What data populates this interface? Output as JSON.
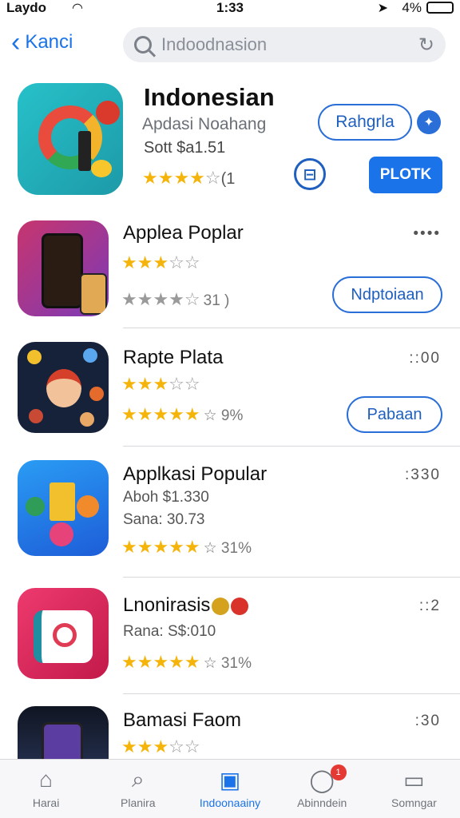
{
  "status_bar": {
    "carrier": "Laydo",
    "time": "1:33",
    "battery_pct": "4%"
  },
  "nav": {
    "back_label": "Kanci",
    "search_text": "Indoodnasion"
  },
  "featured": {
    "title": "Indonesian",
    "subtitle": "Apdasi Noahang",
    "price": "Sott $a1.51",
    "rating_count": "(1",
    "primary_button": "Rahgrla",
    "action_button": "PLOTK"
  },
  "rows": [
    {
      "name": "Applea Poplar",
      "stars_top": "★★★☆☆",
      "stars_bottom": "★★★★☆",
      "count": "31 )",
      "menu": "••••",
      "button": "Ndptoiaan"
    },
    {
      "name": "Rapte Plata",
      "stars_top": "★★★☆☆",
      "stars_bottom": "★★★★★",
      "count": "☆ 9%",
      "menu": "::00",
      "button": "Pabaan"
    },
    {
      "name": "Applkasi Popular",
      "sub1": "Aboh $1.330",
      "sub2": "Sana: 30.73",
      "stars_bottom": "★★★★★",
      "count": "☆ 31%",
      "menu": ":330"
    },
    {
      "name": "Lnonirasis",
      "sub1": "Rana: S$:010",
      "stars_bottom": "★★★★★",
      "count": "☆ 31%",
      "menu": "::2"
    },
    {
      "name": "Bamasi Faom",
      "stars_top": "★★★☆☆",
      "menu": ":30"
    }
  ],
  "tabs": [
    {
      "label": "Harai",
      "icon": "home-icon"
    },
    {
      "label": "Planira",
      "icon": "search-icon"
    },
    {
      "label": "Indoonaainy",
      "icon": "apps-icon",
      "active": true
    },
    {
      "label": "Abinndein",
      "icon": "chat-icon",
      "badge": "1"
    },
    {
      "label": "Somngar",
      "icon": "monitor-icon"
    }
  ],
  "colors": {
    "accent": "#1a73e8",
    "star": "#f5b40a"
  }
}
